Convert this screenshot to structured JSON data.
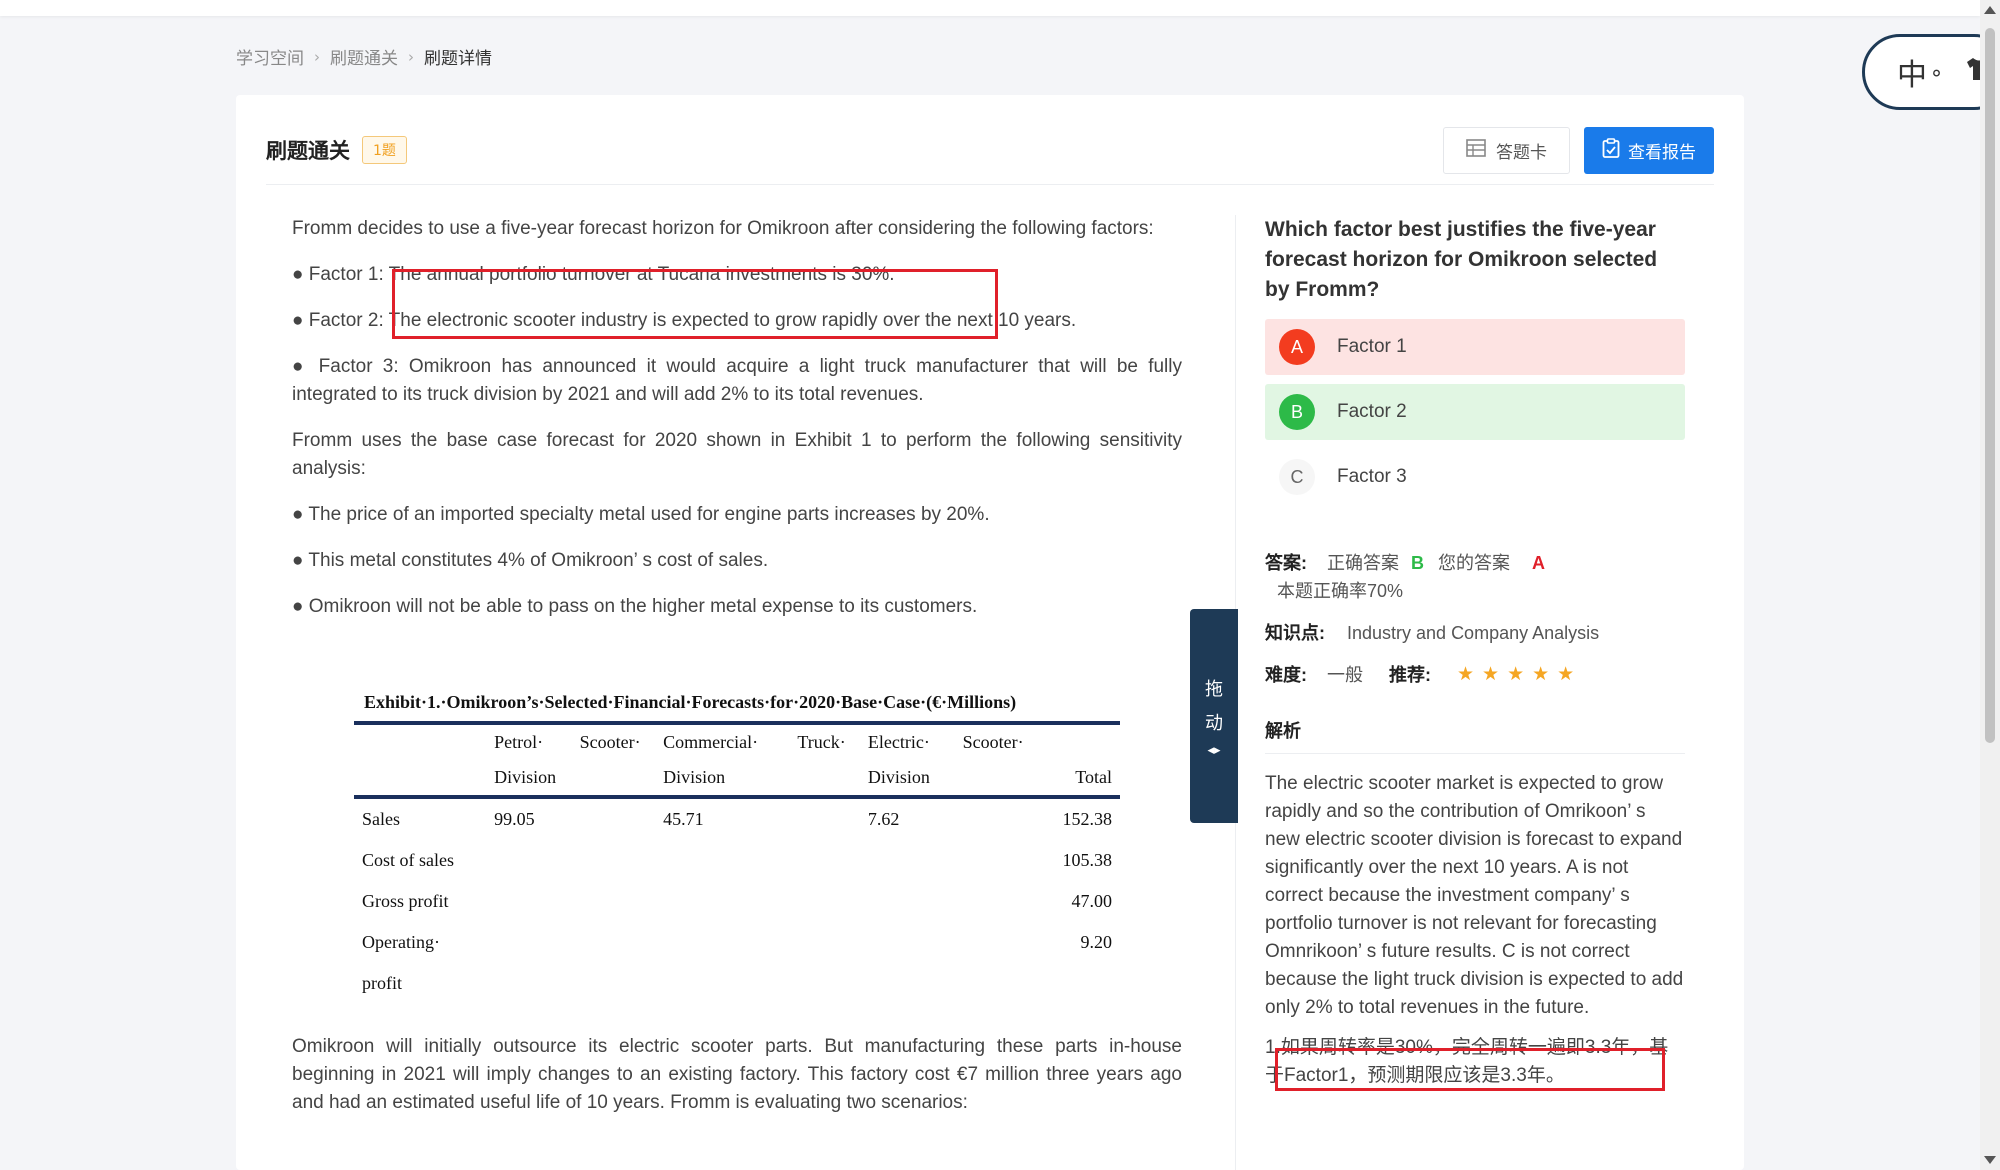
{
  "breadcrumb": [
    "学习空间",
    "刷题通关",
    "刷题详情"
  ],
  "header": {
    "title": "刷题通关",
    "count_badge": "1题",
    "answer_card_label": "答题卡",
    "report_label": "查看报告"
  },
  "passage": {
    "intro": "Fromm decides to use a five-year forecast horizon for Omikroon after considering the following factors:",
    "factor1": "● Factor 1: The annual portfolio turnover at Tucana investments is 30%.",
    "factor2": "● Factor 2: The electronic scooter industry is expected to grow rapidly over the next 10 years.",
    "factor3": "● Factor 3: Omikroon has announced it would acquire a light truck manufacturer that will be fully integrated to its truck division by 2021 and will add 2% to its total revenues.",
    "sensitivity": "Fromm uses the base case forecast for 2020 shown in Exhibit 1 to perform the following sensitivity analysis:",
    "bullet1": "● The price of an imported specialty metal used for engine parts increases by 20%.",
    "bullet2": "● This metal constitutes 4% of Omikroon’ s cost of sales.",
    "bullet3": "● Omikroon will not be able to pass on the higher metal expense to its customers.",
    "closing": "Omikroon will initially outsource its electric scooter parts. But manufacturing these parts in-house beginning in 2021 will imply changes to an existing factory. This factory cost €7 million three years ago and had an estimated useful life of 10 years. Fromm is evaluating two scenarios:"
  },
  "exhibit": {
    "title": "Exhibit·1.·Omikroon’s·Selected·Financial·Forecasts·for·2020·Base·Case·(€·Millions)",
    "header_row1": [
      "",
      "Petrol·",
      "Scooter·",
      "Commercial·",
      "Truck·",
      "Electric·",
      "Scooter·",
      ""
    ],
    "header_row2": [
      "",
      "Division",
      "",
      "Division",
      "",
      "Division",
      "",
      "Total"
    ],
    "rows": [
      {
        "label": "Sales",
        "petrol": "99.05",
        "commercial": "45.71",
        "electric": "7.62",
        "total": "152.38"
      },
      {
        "label": "Cost of sales",
        "petrol": "",
        "commercial": "",
        "electric": "",
        "total": "105.38"
      },
      {
        "label": "Gross profit",
        "petrol": "",
        "commercial": "",
        "electric": "",
        "total": "47.00"
      },
      {
        "label": "Operating·",
        "petrol": "",
        "commercial": "",
        "electric": "",
        "total": "9.20"
      },
      {
        "label": "profit",
        "petrol": "",
        "commercial": "",
        "electric": "",
        "total": ""
      }
    ]
  },
  "drag_handle": {
    "char1": "拖",
    "char2": "动",
    "arrows": "◂▸"
  },
  "question": {
    "text": "Which factor best justifies the five-year forecast horizon for Omikroon selected by Fromm?",
    "options": [
      {
        "letter": "A",
        "text": "Factor 1"
      },
      {
        "letter": "B",
        "text": "Factor 2"
      },
      {
        "letter": "C",
        "text": "Factor 3"
      }
    ]
  },
  "meta": {
    "answer_label": "答案:",
    "correct_label": "正确答案",
    "correct_letter": "B",
    "your_label": "您的答案",
    "your_letter": "A",
    "accuracy": "本题正确率70%",
    "knowledge_label": "知识点:",
    "knowledge_value": "Industry and Company Analysis",
    "difficulty_label": "难度:",
    "difficulty_value": "一般",
    "recommend_label": "推荐:",
    "stars": "★★★★★"
  },
  "analysis": {
    "title": "解析",
    "body": "The electric scooter market is expected to grow rapidly and so the contribution of Omrikoon’ s new electric scooter division is forecast to expand significantly over the next 10 years. A is not correct because the investment company’ s portfolio turnover is not relevant for forecasting Omnrikoon’ s future results. C is not correct because the light truck division is expected to add only 2% to total revenues in the future.",
    "note": "1.如果周转率是30%，完全周转一遍即3.3年，基于Factor1，预测期限应该是3.3年。"
  },
  "ime": {
    "char": "中",
    "dot": "°",
    "shirt": "👕"
  },
  "colors": {
    "primary": "#1a7bea",
    "wrong": "#f33c1f",
    "right": "#2dba48",
    "highlight": "#e0202a"
  }
}
